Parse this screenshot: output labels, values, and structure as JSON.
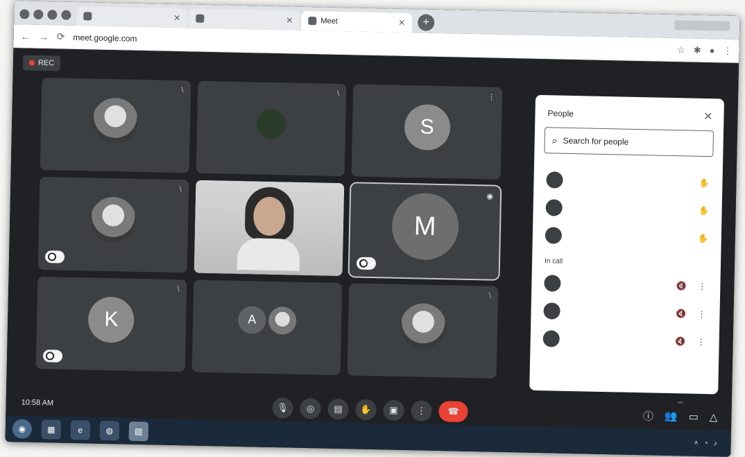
{
  "browser": {
    "tabs": [
      {
        "label": "",
        "active": false
      },
      {
        "label": "",
        "active": false
      },
      {
        "label": "Meet",
        "active": true
      }
    ],
    "url": "meet.google.com"
  },
  "meet": {
    "rec_label": "REC",
    "tiles": [
      {
        "name": "",
        "type": "photo",
        "mic": "⧵"
      },
      {
        "name": "",
        "type": "plant",
        "mic": "⧵"
      },
      {
        "name": "",
        "type": "letter",
        "letter": "S",
        "mic": "⋮"
      },
      {
        "name": "",
        "type": "photo",
        "pinned": true,
        "mic": "⧵"
      },
      {
        "name": "",
        "type": "video",
        "mic": ""
      },
      {
        "name": "",
        "type": "big",
        "letter": "M",
        "pinned": true,
        "active": true,
        "mic": "◉"
      },
      {
        "name": "",
        "type": "letter",
        "letter": "K",
        "pinned": true,
        "mic": "⧵"
      },
      {
        "name": "",
        "type": "duo",
        "letter": "A",
        "mic": ""
      },
      {
        "name": "",
        "type": "photo",
        "mic": "⧵"
      }
    ]
  },
  "panel": {
    "title": "People",
    "search_placeholder": "Search for people",
    "sections": [
      {
        "label": "",
        "people": [
          {
            "name": "",
            "icon": "✋"
          },
          {
            "name": "",
            "icon": "✋"
          },
          {
            "name": "",
            "icon": "✋"
          }
        ]
      },
      {
        "label": "In call",
        "people": [
          {
            "name": "",
            "icon1": "🔇",
            "icon2": "⋮"
          },
          {
            "name": "",
            "icon1": "🔇",
            "icon2": "⋮"
          },
          {
            "name": "",
            "icon1": "🔇",
            "icon2": "⋮"
          }
        ]
      }
    ]
  },
  "bottombar": {
    "time": "10:58 AM",
    "participant_count": ""
  },
  "taskbar": {
    "clock_time": "",
    "clock_date": ""
  },
  "colors": {
    "meet_bg": "#202124",
    "tile_bg": "#3c4043",
    "leave_red": "#ea4335"
  }
}
